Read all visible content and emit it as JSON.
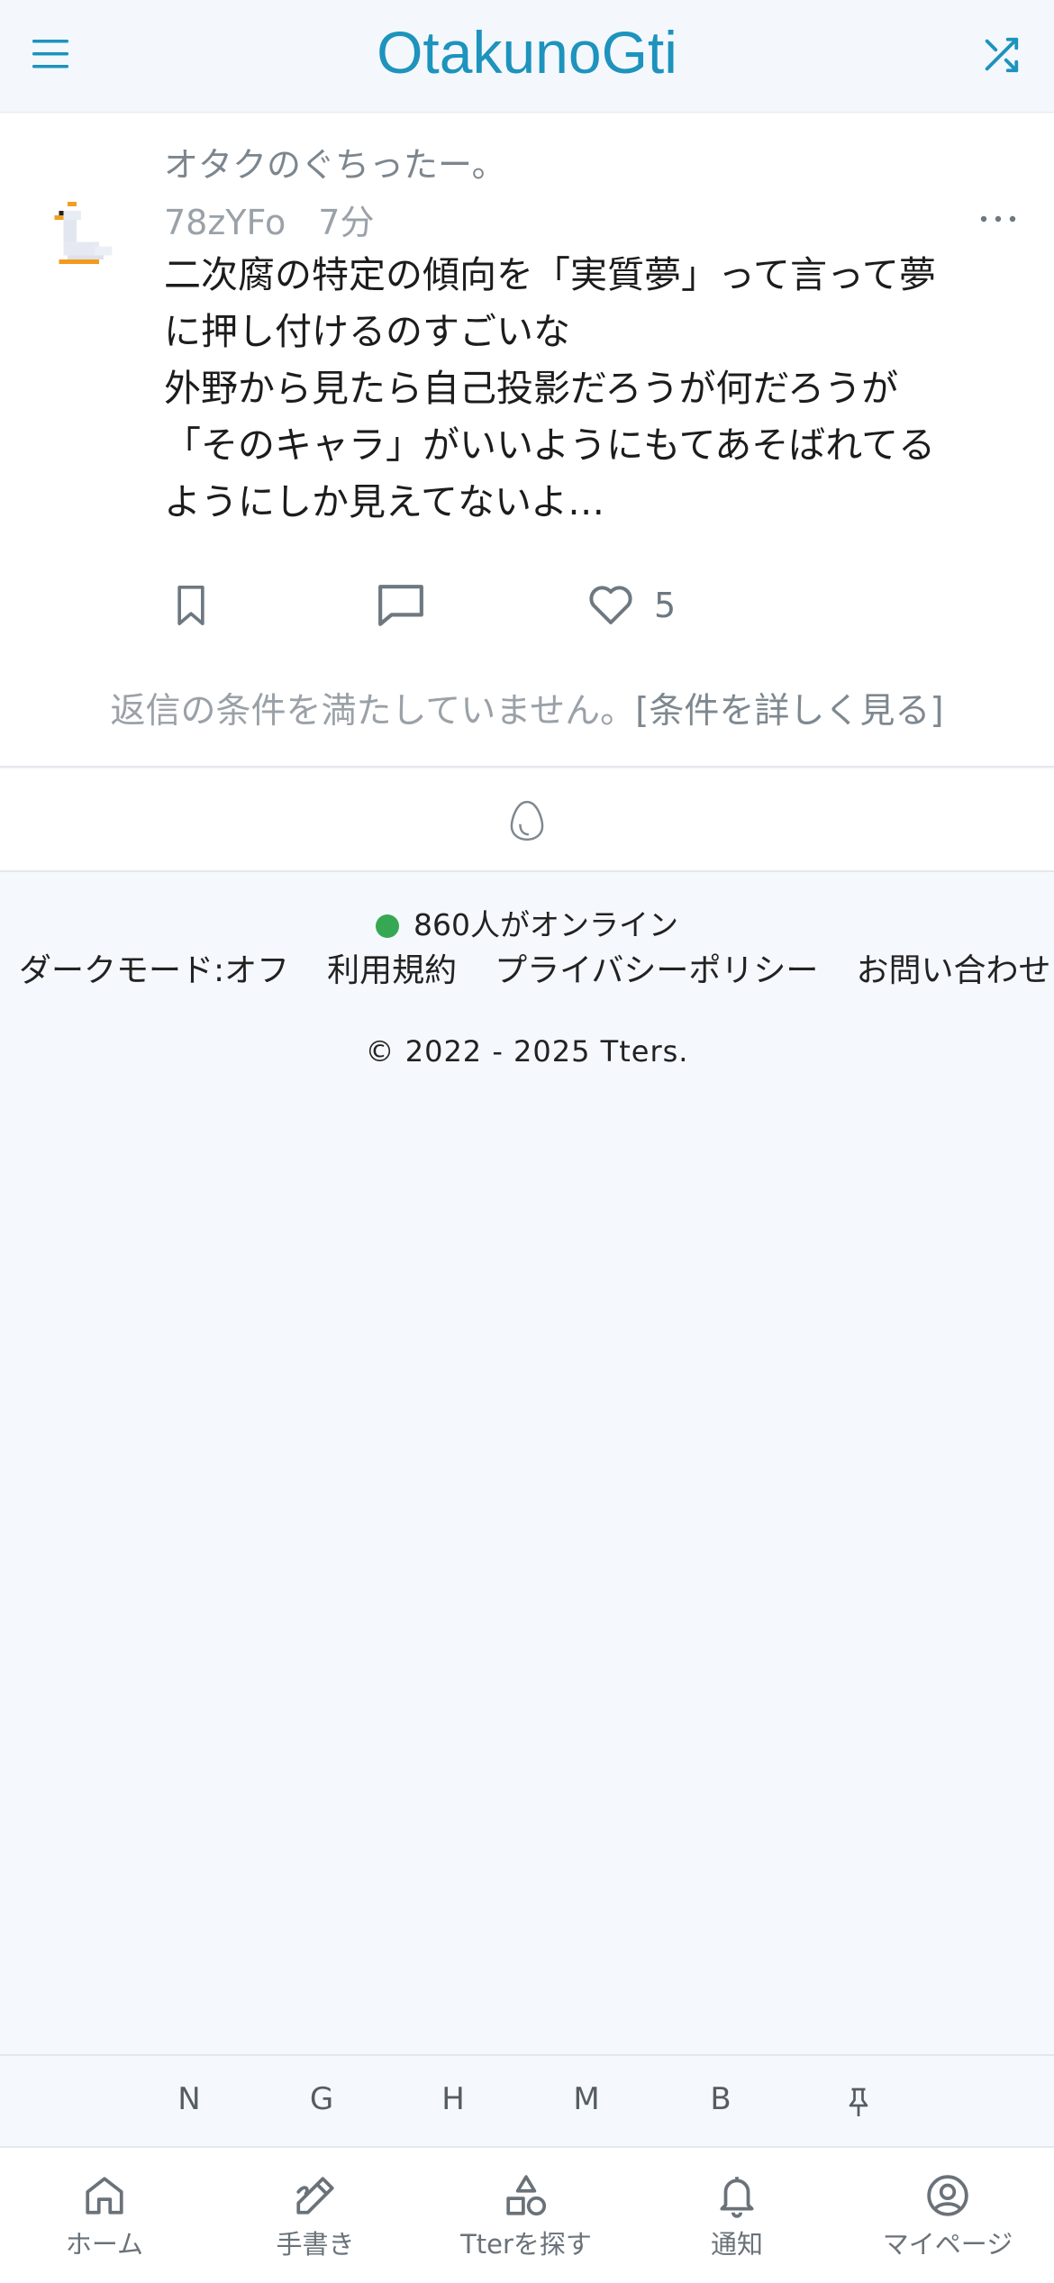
{
  "header": {
    "title": "OtakunoGti",
    "menu_icon": "hamburger-icon",
    "shuffle_icon": "shuffle-icon",
    "accent_color": "#1d93bd"
  },
  "post": {
    "community": "オタクのぐちったー。",
    "user_id": "78zYFo",
    "time": "7分",
    "body": "二次腐の特定の傾向を「実質夢」って言って夢\nに押し付けるのすごいな\n外野から見たら自己投影だろうが何だろうが\n「そのキャラ」がいいようにもてあそばれてる\nようにしか見えてないよ…",
    "like_count": "5",
    "reply_notice": "返信の条件を満たしていません。",
    "reply_notice_link": "[条件を詳しく見る]"
  },
  "footer": {
    "online": "860人がオンライン",
    "links": [
      "ダークモード:オフ",
      "利用規約",
      "プライバシーポリシー",
      "お問い合わせ"
    ],
    "copyright": "© 2022 - 2025 Tters."
  },
  "letterbar": [
    "N",
    "G",
    "H",
    "M",
    "B"
  ],
  "tabs": [
    {
      "label": "ホーム",
      "icon": "home-icon"
    },
    {
      "label": "手書き",
      "icon": "pen-icon"
    },
    {
      "label": "Tterを探す",
      "icon": "shapes-icon"
    },
    {
      "label": "通知",
      "icon": "bell-icon"
    },
    {
      "label": "マイページ",
      "icon": "user-circle-icon"
    }
  ]
}
